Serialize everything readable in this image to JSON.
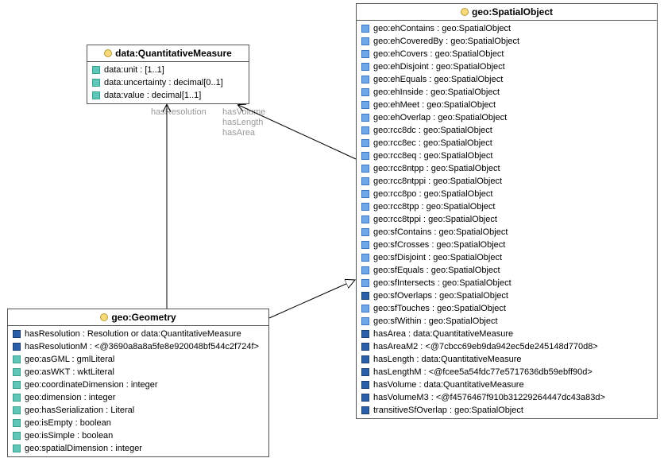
{
  "classes": {
    "qm": {
      "title": "data:QuantitativeMeasure",
      "attrs": [
        {
          "icon": "sq-teal",
          "text": "data:unit : [1..1]"
        },
        {
          "icon": "sq-teal",
          "text": "data:uncertainty : decimal[0..1]"
        },
        {
          "icon": "sq-teal",
          "text": "data:value : decimal[1..1]"
        }
      ]
    },
    "geom": {
      "title": "geo:Geometry",
      "attrs": [
        {
          "icon": "sq-blue-dark",
          "text": "hasResolution : Resolution or data:QuantitativeMeasure"
        },
        {
          "icon": "sq-blue-dark",
          "text": "hasResolutionM : <@3690a8a8a5fe8e920048bf544c2f724f>"
        },
        {
          "icon": "sq-teal",
          "text": "geo:asGML : gmlLiteral"
        },
        {
          "icon": "sq-teal",
          "text": "geo:asWKT : wktLiteral"
        },
        {
          "icon": "sq-teal",
          "text": "geo:coordinateDimension : integer"
        },
        {
          "icon": "sq-teal",
          "text": "geo:dimension : integer"
        },
        {
          "icon": "sq-teal",
          "text": "geo:hasSerialization : Literal"
        },
        {
          "icon": "sq-teal",
          "text": "geo:isEmpty : boolean"
        },
        {
          "icon": "sq-teal",
          "text": "geo:isSimple : boolean"
        },
        {
          "icon": "sq-teal",
          "text": "geo:spatialDimension : integer"
        }
      ]
    },
    "spatial": {
      "title": "geo:SpatialObject",
      "attrs": [
        {
          "icon": "sq-blue-mid",
          "text": "geo:ehContains : geo:SpatialObject"
        },
        {
          "icon": "sq-blue-mid",
          "text": "geo:ehCoveredBy : geo:SpatialObject"
        },
        {
          "icon": "sq-blue-mid",
          "text": "geo:ehCovers : geo:SpatialObject"
        },
        {
          "icon": "sq-blue-mid",
          "text": "geo:ehDisjoint : geo:SpatialObject"
        },
        {
          "icon": "sq-blue-mid",
          "text": "geo:ehEquals : geo:SpatialObject"
        },
        {
          "icon": "sq-blue-mid",
          "text": "geo:ehInside : geo:SpatialObject"
        },
        {
          "icon": "sq-blue-mid",
          "text": "geo:ehMeet : geo:SpatialObject"
        },
        {
          "icon": "sq-blue-mid",
          "text": "geo:ehOverlap : geo:SpatialObject"
        },
        {
          "icon": "sq-blue-mid",
          "text": "geo:rcc8dc : geo:SpatialObject"
        },
        {
          "icon": "sq-blue-mid",
          "text": "geo:rcc8ec : geo:SpatialObject"
        },
        {
          "icon": "sq-blue-mid",
          "text": "geo:rcc8eq : geo:SpatialObject"
        },
        {
          "icon": "sq-blue-mid",
          "text": "geo:rcc8ntpp : geo:SpatialObject"
        },
        {
          "icon": "sq-blue-mid",
          "text": "geo:rcc8ntppi : geo:SpatialObject"
        },
        {
          "icon": "sq-blue-mid",
          "text": "geo:rcc8po : geo:SpatialObject"
        },
        {
          "icon": "sq-blue-mid",
          "text": "geo:rcc8tpp : geo:SpatialObject"
        },
        {
          "icon": "sq-blue-mid",
          "text": "geo:rcc8tppi : geo:SpatialObject"
        },
        {
          "icon": "sq-blue-mid",
          "text": "geo:sfContains : geo:SpatialObject"
        },
        {
          "icon": "sq-blue-mid",
          "text": "geo:sfCrosses : geo:SpatialObject"
        },
        {
          "icon": "sq-blue-mid",
          "text": "geo:sfDisjoint : geo:SpatialObject"
        },
        {
          "icon": "sq-blue-mid",
          "text": "geo:sfEquals : geo:SpatialObject"
        },
        {
          "icon": "sq-blue-mid",
          "text": "geo:sfIntersects : geo:SpatialObject"
        },
        {
          "icon": "sq-blue-dark",
          "text": "geo:sfOverlaps : geo:SpatialObject"
        },
        {
          "icon": "sq-blue-mid",
          "text": "geo:sfTouches : geo:SpatialObject"
        },
        {
          "icon": "sq-blue-mid",
          "text": "geo:sfWithin : geo:SpatialObject"
        },
        {
          "icon": "sq-blue-dark",
          "text": "hasArea : data:QuantitativeMeasure"
        },
        {
          "icon": "sq-blue-dark",
          "text": "hasAreaM2 : <@7cbcc69eb9da942ec5de245148d770d8>"
        },
        {
          "icon": "sq-blue-dark",
          "text": "hasLength : data:QuantitativeMeasure"
        },
        {
          "icon": "sq-blue-dark",
          "text": "hasLengthM : <@fcee5a54fdc77e5717636db59ebff90d>"
        },
        {
          "icon": "sq-blue-dark",
          "text": "hasVolume : data:QuantitativeMeasure"
        },
        {
          "icon": "sq-blue-dark",
          "text": "hasVolumeM3 : <@f4576467f910b31229264447dc43a83d>"
        },
        {
          "icon": "sq-blue-dark",
          "text": "transitiveSfOverlap : geo:SpatialObject"
        }
      ]
    }
  },
  "edge_labels": {
    "hasResolution": "hasResolution",
    "hasVolume": "hasVolume",
    "hasLength": "hasLength",
    "hasArea": "hasArea"
  }
}
